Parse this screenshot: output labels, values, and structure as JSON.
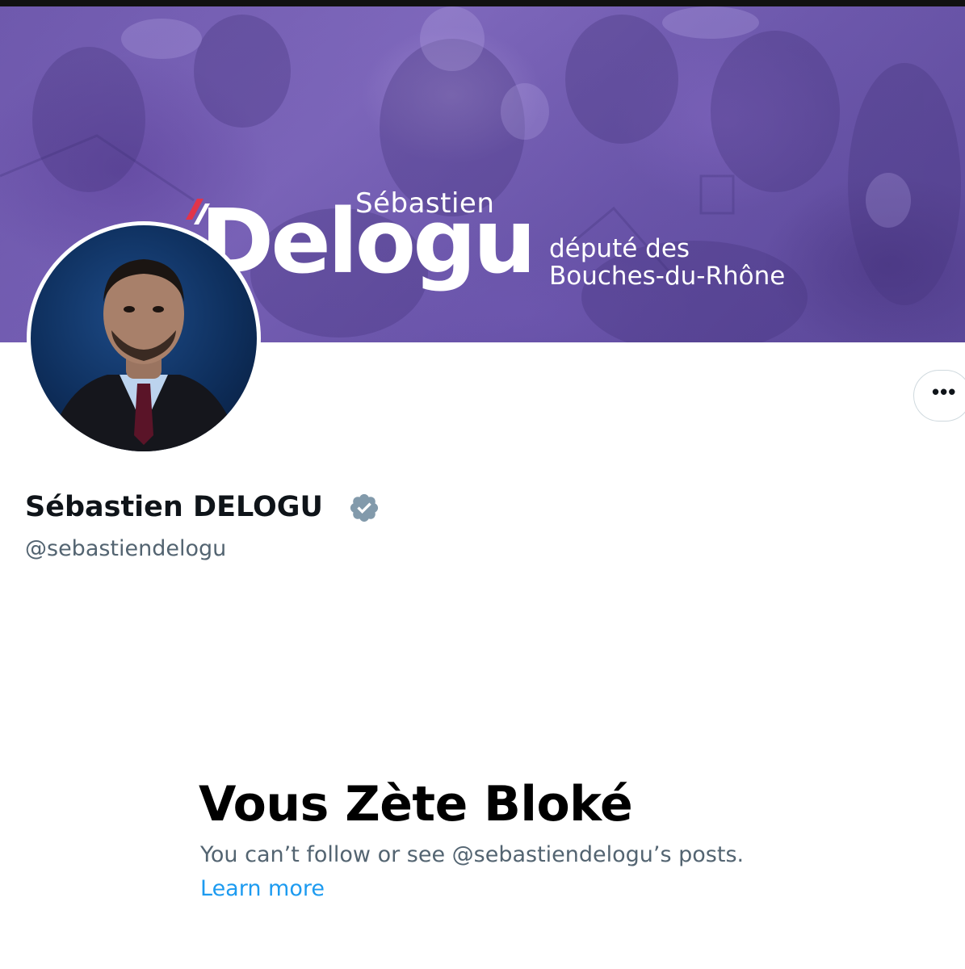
{
  "banner": {
    "first_name": "Sébastien",
    "last_name": "Delogu",
    "subtitle_line1": "député des",
    "subtitle_line2": "Bouches-du-Rhône"
  },
  "profile": {
    "display_name": "Sébastien DELOGU",
    "handle": "@sebastiendelogu",
    "verified": true,
    "more_label": "•••"
  },
  "blocked": {
    "title": "Vous Zète Bloké",
    "description": "You can’t follow or see @sebastiendelogu’s posts.",
    "learn_more": "Learn more"
  },
  "colors": {
    "banner_purple": "#7562b3",
    "text_primary": "#0f1419",
    "text_secondary": "#536471",
    "link": "#1d9bf0",
    "verified_badge": "#829aab"
  }
}
